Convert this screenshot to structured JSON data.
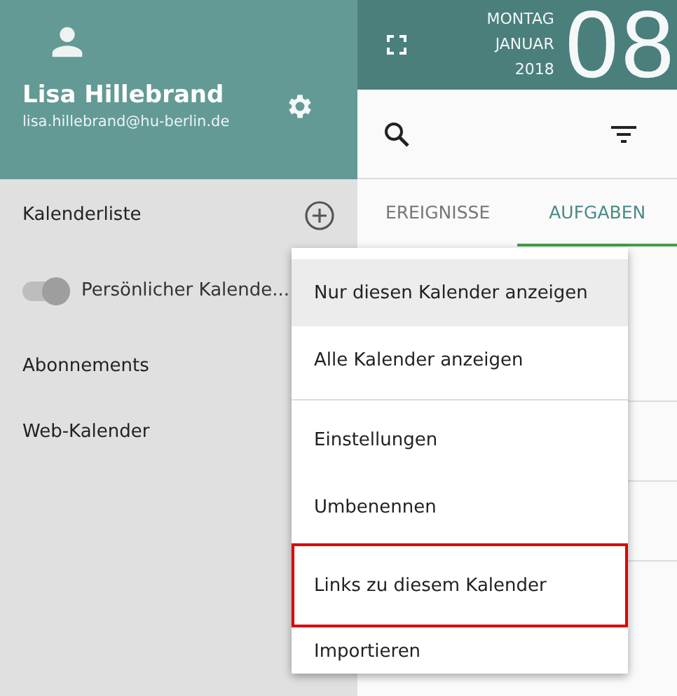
{
  "account": {
    "name": "Lisa Hillebrand",
    "email": "lisa.hillebrand@hu-berlin.de"
  },
  "date": {
    "weekday": "MONTAG",
    "month": "JANUAR",
    "year": "2018",
    "day": "08"
  },
  "sidebar": {
    "items": [
      {
        "kind": "header",
        "label": "Kalenderliste"
      },
      {
        "kind": "toggle",
        "label": "Persönlicher Kalende...",
        "on": true
      },
      {
        "kind": "link",
        "label": "Abonnements"
      },
      {
        "kind": "link",
        "label": "Web-Kalender"
      }
    ]
  },
  "tabs": [
    {
      "label": "EREIGNISSE",
      "selected": false
    },
    {
      "label": "AUFGABEN",
      "selected": true
    }
  ],
  "menu": [
    {
      "kind": "item",
      "label": "Nur diesen Kalender anzeigen",
      "selected": true,
      "outlined": false
    },
    {
      "kind": "item",
      "label": "Alle Kalender anzeigen",
      "selected": false,
      "outlined": false
    },
    {
      "kind": "divider"
    },
    {
      "kind": "item",
      "label": "Einstellungen",
      "selected": false,
      "outlined": false
    },
    {
      "kind": "item",
      "label": "Umbenennen",
      "selected": false,
      "outlined": false
    },
    {
      "kind": "item",
      "label": "Links zu diesem Kalender",
      "selected": false,
      "outlined": true
    },
    {
      "kind": "item",
      "label": "Importieren",
      "selected": false,
      "outlined": false
    }
  ]
}
